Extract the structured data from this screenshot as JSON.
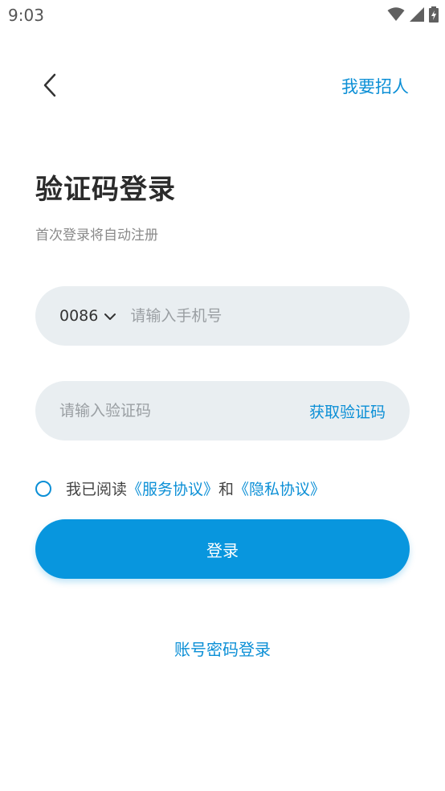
{
  "status_bar": {
    "time": "9:03",
    "icons": [
      "wifi-icon",
      "signal-icon",
      "battery-charging-icon"
    ]
  },
  "header": {
    "back_icon": "chevron-left-icon",
    "recruit_label": "我要招人"
  },
  "title": "验证码登录",
  "subtitle": "首次登录将自动注册",
  "phone_field": {
    "country_code": "0086",
    "dropdown_icon": "chevron-down-icon",
    "value": "",
    "placeholder": "请输入手机号"
  },
  "code_field": {
    "value": "",
    "placeholder": "请输入验证码",
    "get_code_label": "获取验证码"
  },
  "agreement": {
    "checked": false,
    "prefix": "我已阅读",
    "service_link": "《服务协议》",
    "conjunction": "和",
    "privacy_link": "《隐私协议》"
  },
  "login_button": "登录",
  "password_login_link": "账号密码登录",
  "colors": {
    "accent": "#0896de",
    "link": "#0b8fd6",
    "field_bg": "#e9eef1"
  }
}
